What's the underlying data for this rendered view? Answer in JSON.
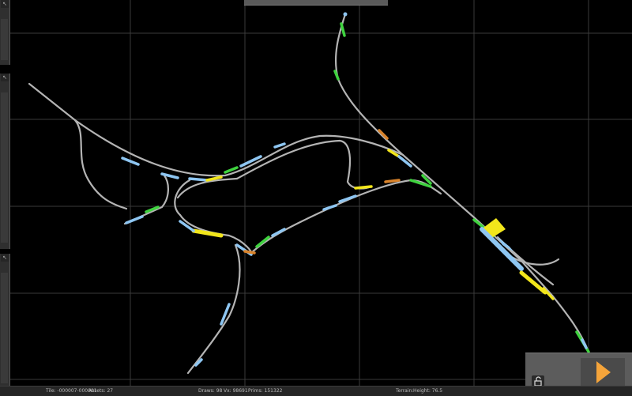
{
  "status_bar": {
    "tile": "Tile: -000007-000001",
    "assets": "Assets: 27",
    "draws": "Draws: 98",
    "vx": "Vx: 98691",
    "prims": "Prims: 151322",
    "terrain": "Terrain:",
    "height": "Height:  76.5"
  },
  "icons": {
    "panel_grip": "resize-grip-icon",
    "lock": "padlock-open-icon",
    "play": "play-triangle-icon"
  },
  "colors": {
    "background": "#000000",
    "grid": "#3a3a3a",
    "track": "#b4b4b4",
    "track_marker_blue": "#8ec6f2",
    "track_marker_green": "#3fd23f",
    "track_marker_yellow": "#f2e61b",
    "track_marker_orange": "#d9832b",
    "play_accent": "#f5a43a"
  }
}
